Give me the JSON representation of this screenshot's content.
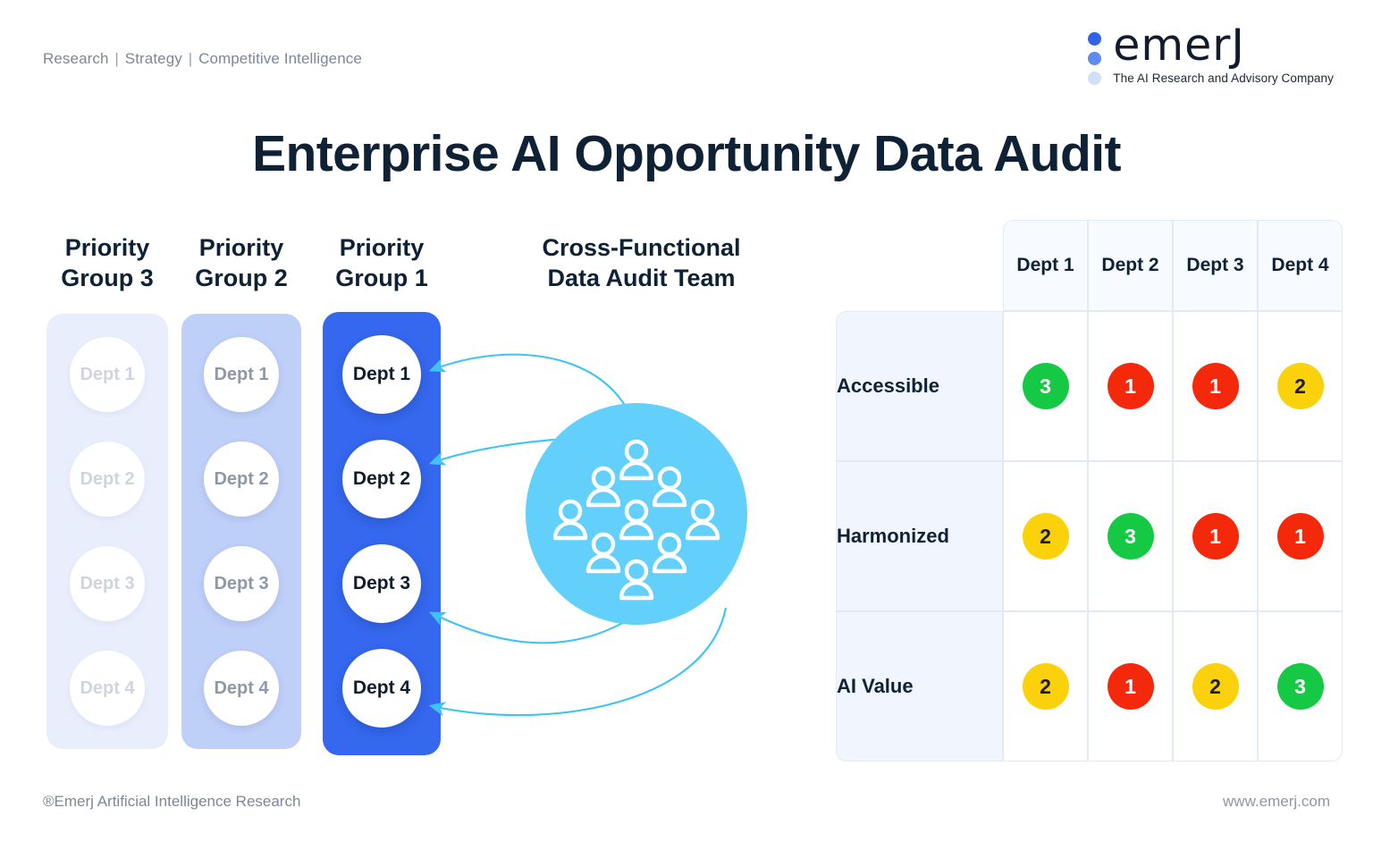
{
  "header": {
    "tagline_parts": [
      "Research",
      "Strategy",
      "Competitive Intelligence"
    ],
    "tagline_separator": "|",
    "logo_wordmark": "emerJ",
    "logo_subtitle": "The AI Research and Advisory Company",
    "logo_dot_colors": [
      "#2f63e8",
      "#5d8bf4",
      "#cfe0fb"
    ]
  },
  "title": "Enterprise AI Opportunity Data Audit",
  "diagram": {
    "groups": [
      {
        "id": "g3",
        "heading_line1": "Priority",
        "heading_line2": "Group 3",
        "panel_color": "#e9eefd",
        "depts": [
          "Dept 1",
          "Dept 2",
          "Dept 3",
          "Dept 4"
        ]
      },
      {
        "id": "g2",
        "heading_line1": "Priority",
        "heading_line2": "Group 2",
        "panel_color": "#becff8",
        "depts": [
          "Dept 1",
          "Dept 2",
          "Dept 3",
          "Dept 4"
        ]
      },
      {
        "id": "g1",
        "heading_line1": "Priority",
        "heading_line2": "Group 1",
        "panel_color": "#3568ef",
        "depts": [
          "Dept 1",
          "Dept 2",
          "Dept 3",
          "Dept 4"
        ]
      }
    ],
    "team": {
      "heading_line1": "Cross-Functional",
      "heading_line2": "Data Audit Team",
      "circle_color": "#62d0fb",
      "person_icon_count": 9,
      "connector_color": "#3ec4f2",
      "connector_count": 4
    }
  },
  "chart_data": {
    "type": "heatmap",
    "title": "Enterprise AI Opportunity Data Audit",
    "columns": [
      "Dept 1",
      "Dept 2",
      "Dept 3",
      "Dept 4"
    ],
    "rows": [
      "Accessible",
      "Harmonized",
      "AI Value"
    ],
    "values": [
      [
        3,
        1,
        1,
        2
      ],
      [
        2,
        3,
        1,
        1
      ],
      [
        2,
        1,
        2,
        3
      ]
    ],
    "colors": [
      [
        "green",
        "red",
        "red",
        "yellow"
      ],
      [
        "yellow",
        "green",
        "red",
        "red"
      ],
      [
        "yellow",
        "red",
        "yellow",
        "green"
      ]
    ],
    "color_scale": {
      "1": "#f4290c",
      "2": "#fad10b",
      "3": "#16c944"
    },
    "value_range": [
      1,
      3
    ],
    "legend": "none",
    "grid": true
  },
  "footer": {
    "left": "®Emerj Artificial Intelligence Research",
    "right": "www.emerj.com"
  }
}
